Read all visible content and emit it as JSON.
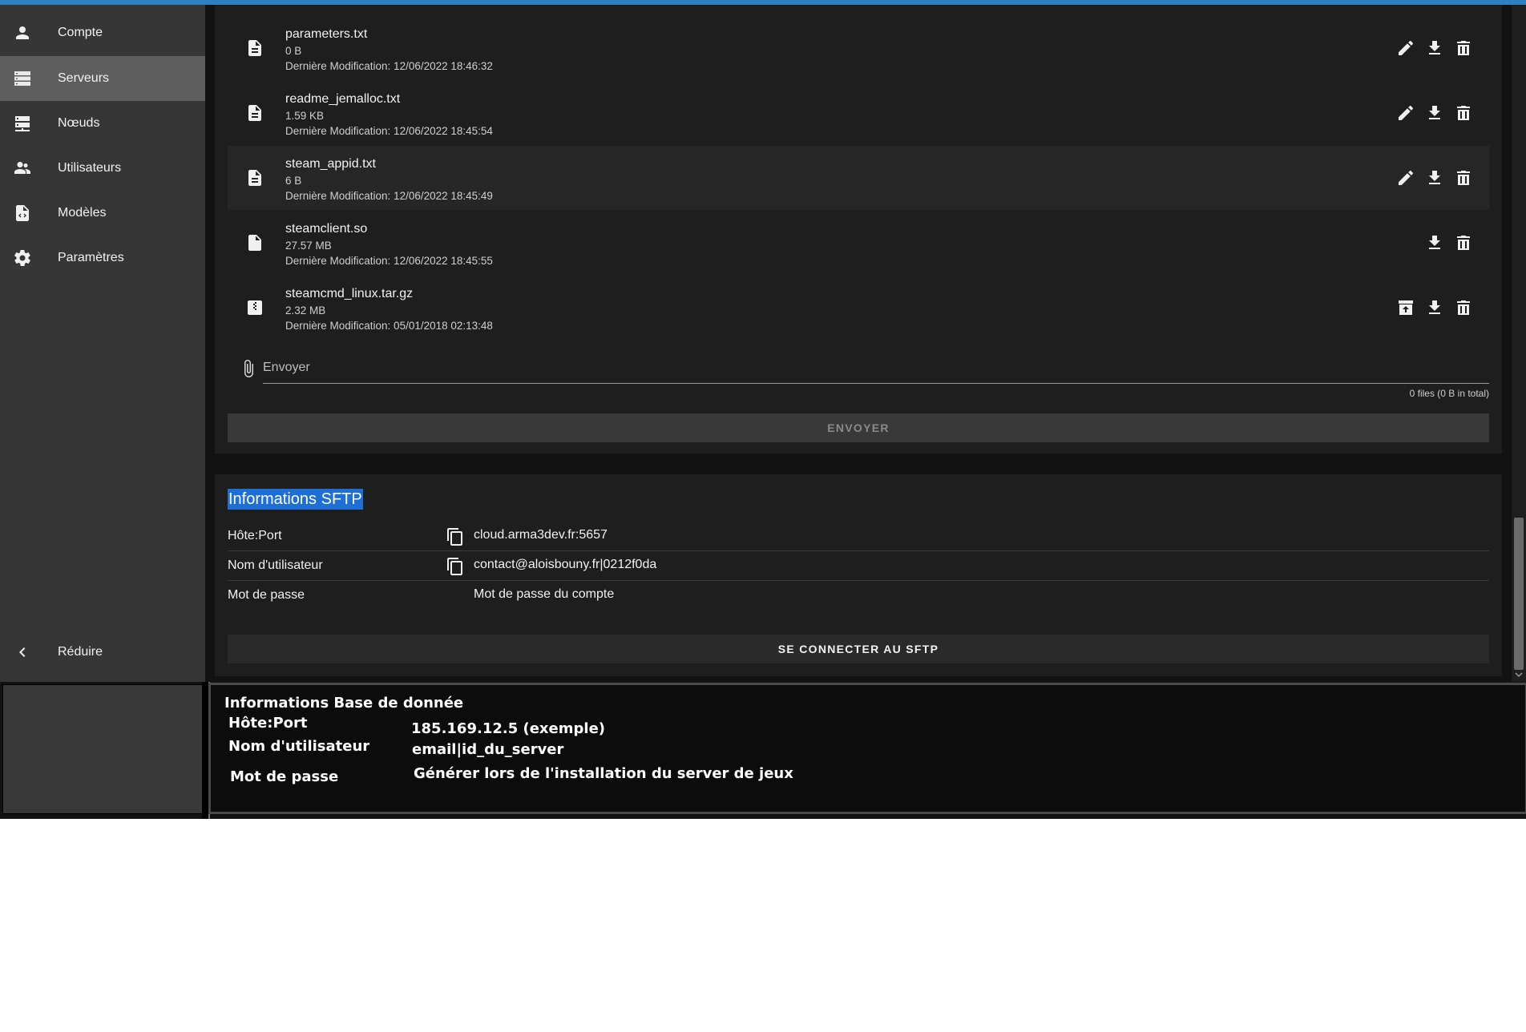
{
  "sidebar": {
    "items": [
      {
        "label": "Compte",
        "icon": "account-icon",
        "active": false
      },
      {
        "label": "Serveurs",
        "icon": "servers-icon",
        "active": true
      },
      {
        "label": "Nœuds",
        "icon": "nodes-icon",
        "active": false
      },
      {
        "label": "Utilisateurs",
        "icon": "users-icon",
        "active": false
      },
      {
        "label": "Modèles",
        "icon": "templates-icon",
        "active": false
      },
      {
        "label": "Paramètres",
        "icon": "gear-icon",
        "active": false
      }
    ],
    "collapse_label": "Réduire"
  },
  "files": [
    {
      "name": "parameters.txt",
      "size": "0 B",
      "modified": "Dernière Modification: 12/06/2022 18:46:32",
      "icon": "text-file-icon",
      "actions": [
        "edit-icon",
        "download-icon",
        "delete-icon"
      ]
    },
    {
      "name": "readme_jemalloc.txt",
      "size": "1.59 KB",
      "modified": "Dernière Modification: 12/06/2022 18:45:54",
      "icon": "text-file-icon",
      "actions": [
        "edit-icon",
        "download-icon",
        "delete-icon"
      ]
    },
    {
      "name": "steam_appid.txt",
      "size": "6 B",
      "modified": "Dernière Modification: 12/06/2022 18:45:49",
      "icon": "text-file-icon",
      "actions": [
        "edit-icon",
        "download-icon",
        "delete-icon"
      ]
    },
    {
      "name": "steamclient.so",
      "size": "27.57 MB",
      "modified": "Dernière Modification: 12/06/2022 18:45:55",
      "icon": "file-icon",
      "actions": [
        "download-icon",
        "delete-icon"
      ]
    },
    {
      "name": "steamcmd_linux.tar.gz",
      "size": "2.32 MB",
      "modified": "Dernière Modification: 05/01/2018 02:13:48",
      "icon": "archive-file-icon",
      "actions": [
        "unarchive-icon",
        "download-icon",
        "delete-icon"
      ]
    }
  ],
  "upload": {
    "placeholder": "Envoyer",
    "files_count": "0 files (0 B in total)",
    "send_label": "ENVOYER"
  },
  "sftp": {
    "title": "Informations SFTP",
    "rows": [
      {
        "label": "Hôte:Port",
        "value": "cloud.arma3dev.fr:5657"
      },
      {
        "label": "Nom d'utilisateur",
        "value": "contact@aloisbouny.fr|0212f0da"
      },
      {
        "label": "Mot de passe",
        "value": "Mot de passe du compte"
      }
    ],
    "connect_label": "SE CONNECTER AU SFTP"
  },
  "db_info": {
    "title": "Informations Base de donnée",
    "host_label": "Hôte:Port",
    "host_value": "185.169.12.5 (exemple)",
    "user_label": "Nom d'utilisateur",
    "user_value": "email|id_du_server",
    "password_label": "Mot de passe",
    "password_value": "Générer lors de l'installation du server de jeux"
  },
  "colors": {
    "accent": "#2f80c1",
    "selection": "#1d6fd6",
    "sidebar_bg": "#363636",
    "card_bg": "#1e1e1e"
  }
}
